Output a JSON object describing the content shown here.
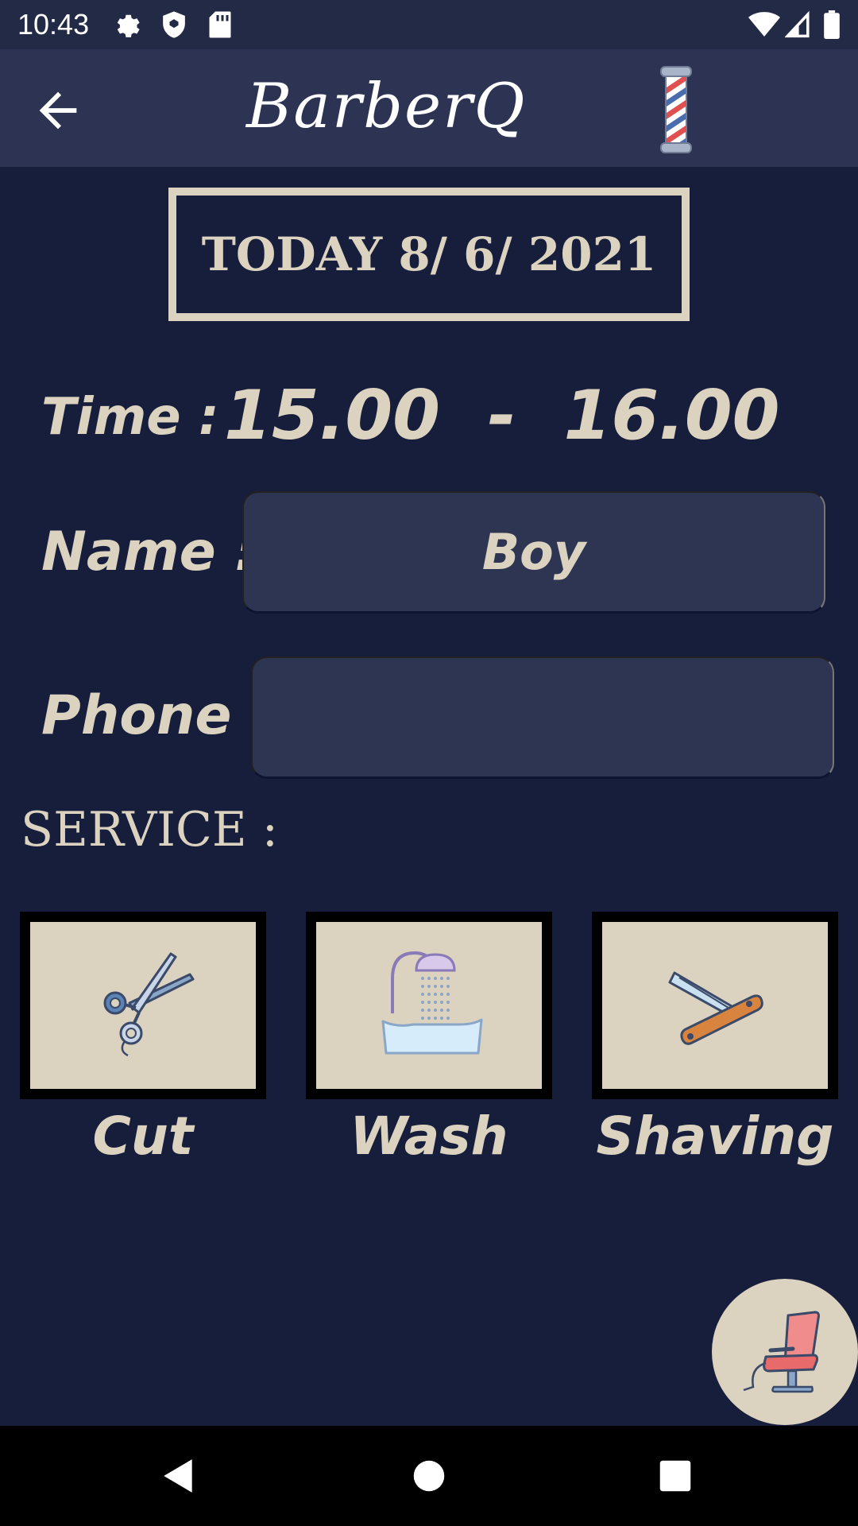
{
  "status_bar": {
    "time": "10:43",
    "icons": [
      "settings-icon",
      "shield-icon",
      "sd-card-icon",
      "wifi-icon",
      "signal-icon",
      "battery-icon"
    ]
  },
  "app_bar": {
    "title": "BarberQ",
    "back_icon": "arrow-left-icon",
    "logo_icon": "barber-pole-icon"
  },
  "date_banner": {
    "text": "TODAY 8/ 6/ 2021"
  },
  "form": {
    "time_label": "Time :",
    "time_value": "15.00  -  16.00",
    "name_label": "Name :",
    "name_value": "Boy",
    "phone_label": "Phone :",
    "phone_value": "",
    "service_label": "SERVICE :"
  },
  "services": [
    {
      "label": "Cut",
      "icon": "scissors-icon"
    },
    {
      "label": "Wash",
      "icon": "hair-wash-sink-icon"
    },
    {
      "label": "Shaving",
      "icon": "straight-razor-icon"
    }
  ],
  "fab": {
    "icon": "barber-chair-icon"
  },
  "nav_bar": {
    "icons": [
      "back-triangle-icon",
      "home-circle-icon",
      "recents-square-icon"
    ]
  },
  "colors": {
    "background": "#171e3c",
    "app_bar": "#2d3352",
    "accent_cream": "#dbd2c0",
    "field_bg": "#2e3552"
  }
}
